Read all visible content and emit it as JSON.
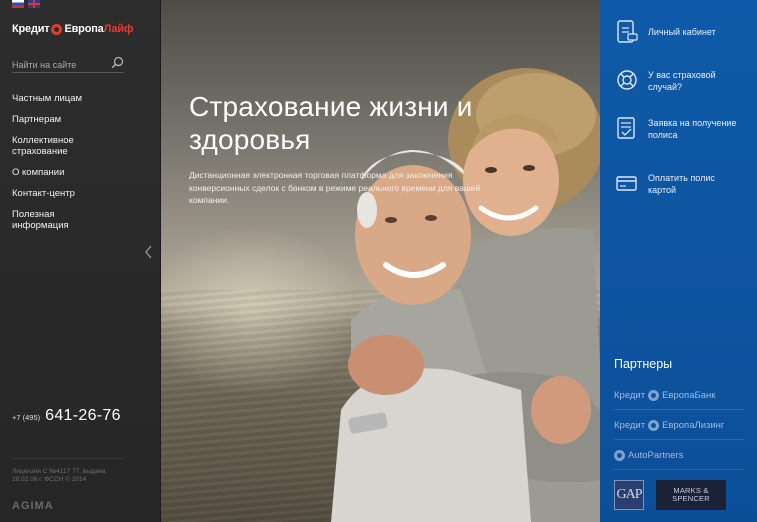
{
  "brand": {
    "logo_part1": "Кредит",
    "logo_part2": "Европа",
    "logo_part3": "Лайф"
  },
  "search": {
    "placeholder": "Найти на сайте"
  },
  "nav": {
    "items": [
      {
        "label": "Частным лицам"
      },
      {
        "label": "Партнерам"
      },
      {
        "label": "Коллективное страхование"
      },
      {
        "label": "О компании"
      },
      {
        "label": "Контакт-центр"
      },
      {
        "label": "Полезная информация"
      }
    ]
  },
  "contact": {
    "phone_code": "+7 (495)",
    "phone_number": "641-26-76"
  },
  "footer": {
    "license": "Лицензия С №4117 77, выдана 28.02.08 г. ФССН © 2014",
    "developer": "AGIMA"
  },
  "hero": {
    "title": "Страхование жизни и здоровья",
    "subtitle": "Дистанционная электронная торговая платформа для заключения конверсионных сделок с банком в режиме реального времени для вашей компании."
  },
  "actions": [
    {
      "label": "Личный кабинет",
      "icon": "phone-cabinet-icon"
    },
    {
      "label": "У вас страховой случай?",
      "icon": "lifebuoy-icon"
    },
    {
      "label": "Заявка на получение полиса",
      "icon": "policy-document-icon"
    },
    {
      "label": "Оплатить полис картой",
      "icon": "credit-card-icon"
    }
  ],
  "partners": {
    "title": "Партнеры",
    "items": [
      {
        "part1": "Кредит",
        "part2": "ЕвропаБанк"
      },
      {
        "part1": "Кредит",
        "part2": "ЕвропаЛизинг"
      },
      {
        "part1": "",
        "part2": "AutoPartners"
      }
    ],
    "gap": "GAP",
    "ms": "MARKS & SPENCER"
  },
  "colors": {
    "brand_red": "#e63a2e",
    "panel_blue": "#0f5aa8",
    "sidebar_dark": "#2d2d2d"
  }
}
